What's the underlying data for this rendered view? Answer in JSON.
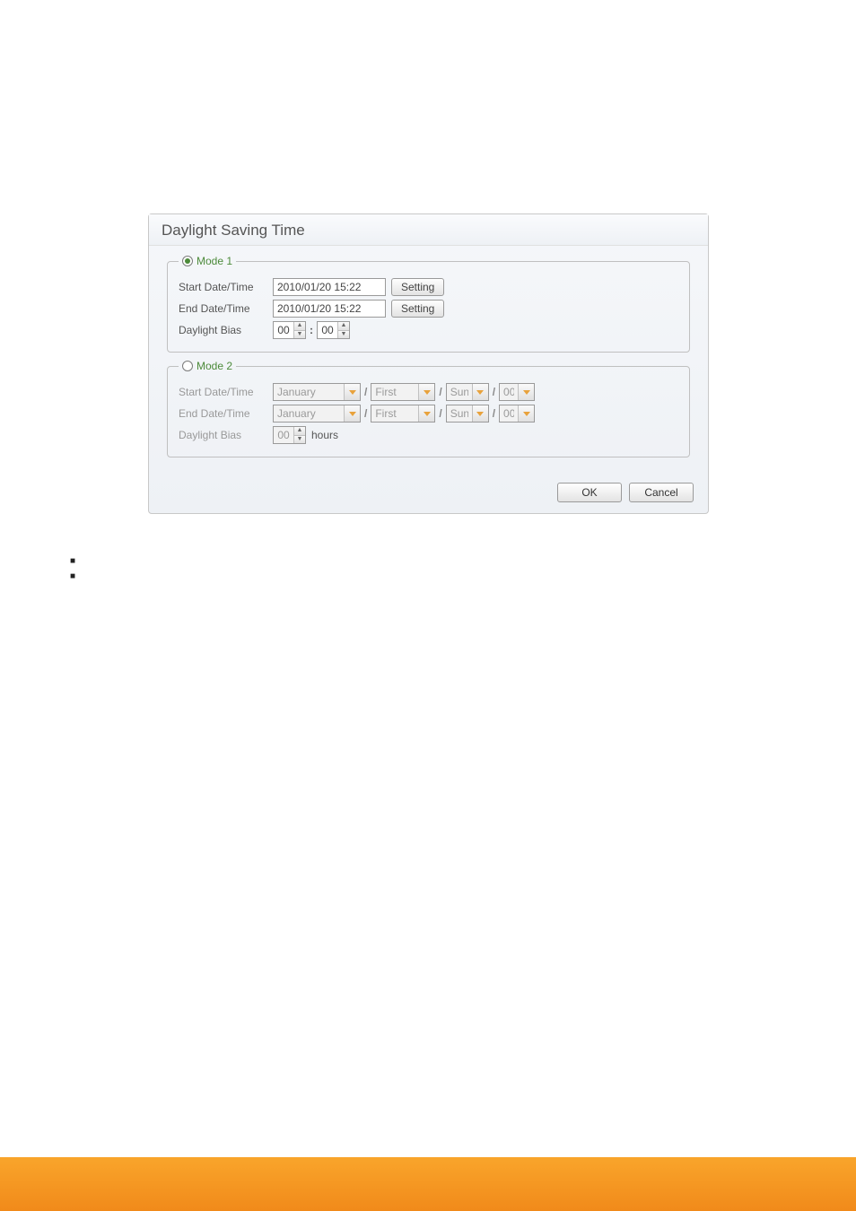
{
  "dialog": {
    "title": "Daylight Saving Time",
    "mode1": {
      "legend": "Mode 1",
      "start_label": "Start Date/Time",
      "end_label": "End Date/Time",
      "bias_label": "Daylight Bias",
      "start_value": "2010/01/20  15:22",
      "end_value": "2010/01/20  15:22",
      "setting_btn": "Setting",
      "bias_hh": "00",
      "bias_mm": "00"
    },
    "mode2": {
      "legend": "Mode 2",
      "start_label": "Start Date/Time",
      "end_label": "End Date/Time",
      "bias_label": "Daylight Bias",
      "month": "January",
      "week": "First",
      "day": "Sun.",
      "hour": "00",
      "bias_val": "00",
      "hours_text": "hours"
    },
    "ok": "OK",
    "cancel": "Cancel"
  }
}
